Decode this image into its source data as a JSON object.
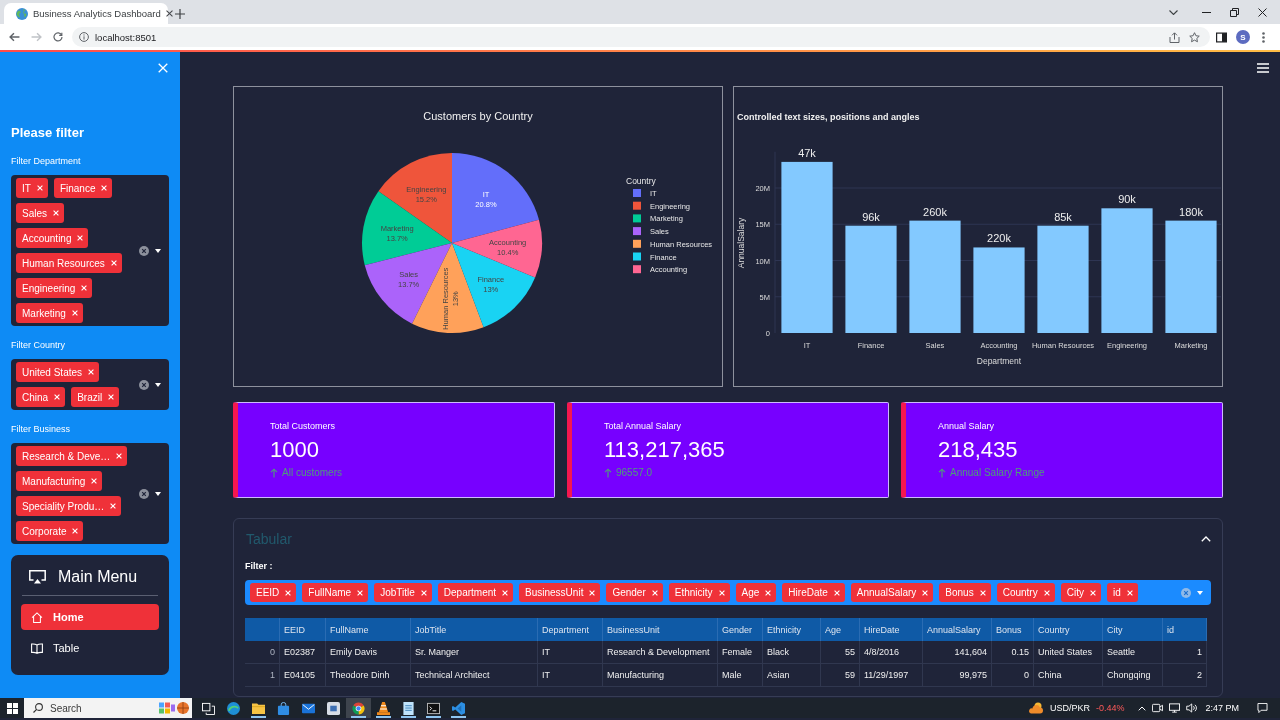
{
  "browser": {
    "tab": {
      "title": "Business Analytics Dashboard",
      "selected": true
    },
    "back_disabled": false,
    "forward_disabled": true,
    "address": "localhost:8501",
    "profile": "S"
  },
  "sidebar": {
    "heading": "Please filter",
    "filters": [
      {
        "label": "Filter Department",
        "tags": [
          "IT",
          "Finance",
          "Sales",
          "Accounting",
          "Human Resources",
          "Engineering",
          "Marketing"
        ]
      },
      {
        "label": "Filter Country",
        "tags": [
          "United States",
          "China",
          "Brazil"
        ]
      },
      {
        "label": "Filter Business",
        "tags": [
          "Research & Deve…",
          "Manufacturing",
          "Speciality Produ…",
          "Corporate"
        ]
      }
    ],
    "menu": {
      "title": "Main Menu",
      "items": [
        {
          "label": "Home",
          "selected": true
        },
        {
          "label": "Table",
          "selected": false
        }
      ]
    }
  },
  "chart_panels": [
    {
      "legend_title": "Country",
      "legend": [
        {
          "label": "IT",
          "color": "#636efa"
        },
        {
          "label": "Engineering",
          "color": "#ef553b"
        },
        {
          "label": "Marketing",
          "color": "#00cc96"
        },
        {
          "label": "Sales",
          "color": "#ab63fa"
        },
        {
          "label": "Human Resources",
          "color": "#ffa15a"
        },
        {
          "label": "Finance",
          "color": "#19d3f3"
        },
        {
          "label": "Accounting",
          "color": "#ff6692"
        }
      ],
      "chart_data": {
        "type": "pie",
        "title": "Customers by Country",
        "categories": [
          "IT",
          "Engineering",
          "Marketing",
          "Sales",
          "Human Resources",
          "Finance",
          "Accounting"
        ],
        "values": [
          20.8,
          15.2,
          13.7,
          13.7,
          13,
          13,
          10.4
        ],
        "value_labels": [
          "20.8%",
          "15.2%",
          "13.7%",
          "13.7%",
          "13%",
          "13%",
          "10.4%"
        ]
      }
    },
    {
      "chart_data": {
        "type": "bar",
        "title": "Controlled text sizes, positions and angles",
        "xlabel": "Department",
        "ylabel": "AnnualSalary",
        "categories": [
          "IT",
          "Finance",
          "Sales",
          "Accounting",
          "Human Resources",
          "Engineering",
          "Marketing"
        ],
        "series": [
          {
            "color": "#83c9ff",
            "values": [
              23600000,
              14800000,
              15500000,
              11800000,
              14800000,
              17200000,
              15500000
            ]
          }
        ],
        "ylim": [
          0,
          25000000
        ],
        "yticks": [
          {
            "value": 0,
            "label": "0"
          },
          {
            "value": 5000000,
            "label": "5M"
          },
          {
            "value": 10000000,
            "label": "10M"
          },
          {
            "value": 15000000,
            "label": "15M"
          },
          {
            "value": 20000000,
            "label": "20M"
          }
        ],
        "grid": true,
        "value_labels": [
          "47k",
          "96k",
          "260k",
          "220k",
          "85k",
          "90k",
          "180k"
        ]
      }
    }
  ],
  "metrics": [
    {
      "label": "Total Customers",
      "value": "1000",
      "delta": "All customers",
      "delta_positive": true
    },
    {
      "label": "Total Annual Salary",
      "value": "113,217,365",
      "delta": "96557.0",
      "delta_positive": true
    },
    {
      "label": "Annual Salary",
      "value": "218,435",
      "delta": "Annual Salary Range",
      "delta_positive": true
    }
  ],
  "tabular": {
    "title": "Tabular",
    "expanded": true,
    "filter_label": "Filter :",
    "selected_columns": [
      "EEID",
      "FullName",
      "JobTitle",
      "Department",
      "BusinessUnit",
      "Gender",
      "Ethnicity",
      "Age",
      "HireDate",
      "AnnualSalary",
      "Bonus",
      "Country",
      "City",
      "id"
    ],
    "table": {
      "columns": [
        "EEID",
        "FullName",
        "JobTitle",
        "Department",
        "BusinessUnit",
        "Gender",
        "Ethnicity",
        "Age",
        "HireDate",
        "AnnualSalary",
        "Bonus",
        "Country",
        "City",
        "id"
      ],
      "rows": [
        {
          "index": "0",
          "cells": [
            "E02387",
            "Emily Davis",
            "Sr. Manger",
            "IT",
            "Research & Development",
            "Female",
            "Black",
            "55",
            "4/8/2016",
            "141,604",
            "0.15",
            "United States",
            "Seattle",
            "1"
          ]
        },
        {
          "index": "1",
          "cells": [
            "E04105",
            "Theodore Dinh",
            "Technical Architect",
            "IT",
            "Manufacturing",
            "Male",
            "Asian",
            "59",
            "11/29/1997",
            "99,975",
            "0",
            "China",
            "Chongqing",
            "2"
          ]
        }
      ]
    }
  },
  "taskbar": {
    "search": {
      "placeholder": "Search"
    },
    "apps": [
      {
        "running": false,
        "active": false
      },
      {
        "running": false,
        "active": false
      },
      {
        "running": true,
        "active": false
      },
      {
        "running": false,
        "active": false
      },
      {
        "running": false,
        "active": false
      },
      {
        "running": false,
        "active": false
      },
      {
        "running": true,
        "active": true
      },
      {
        "running": true,
        "active": false
      },
      {
        "running": true,
        "active": false
      },
      {
        "running": true,
        "active": false
      },
      {
        "running": true,
        "active": false
      }
    ],
    "ticker": {
      "symbol": "USD/PKR",
      "change": "-0.44%"
    },
    "clock": "2:47 PM"
  }
}
